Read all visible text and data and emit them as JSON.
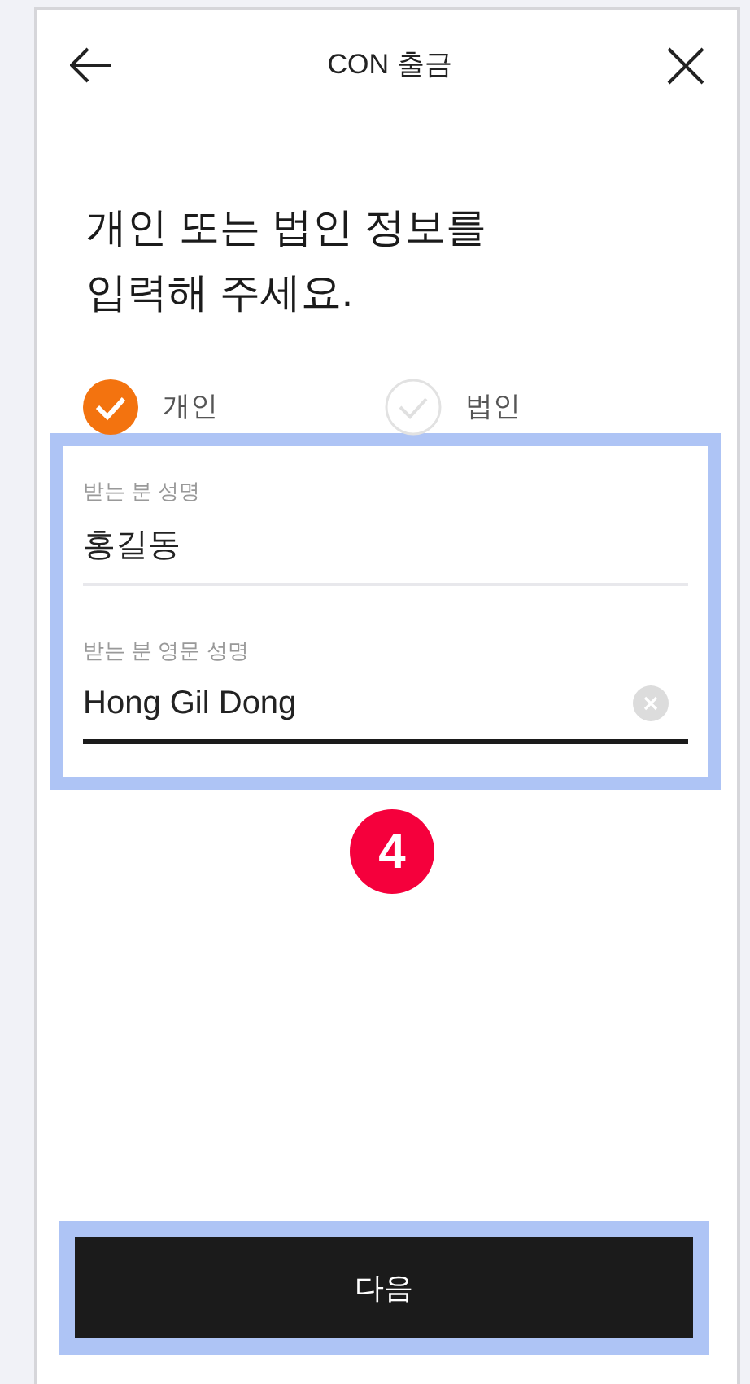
{
  "header": {
    "title": "CON 출금"
  },
  "heading": [
    "개인 또는 법인 정보를",
    "입력해 주세요."
  ],
  "options": [
    {
      "label": "개인",
      "selected": true
    },
    {
      "label": "법인",
      "selected": false
    }
  ],
  "fields": [
    {
      "label": "받는 분 성명",
      "value": "홍길동",
      "focused": false
    },
    {
      "label": "받는 분 영문 성명",
      "value": "Hong Gil Dong",
      "focused": true
    }
  ],
  "step_badge": "4",
  "next_button": "다음"
}
